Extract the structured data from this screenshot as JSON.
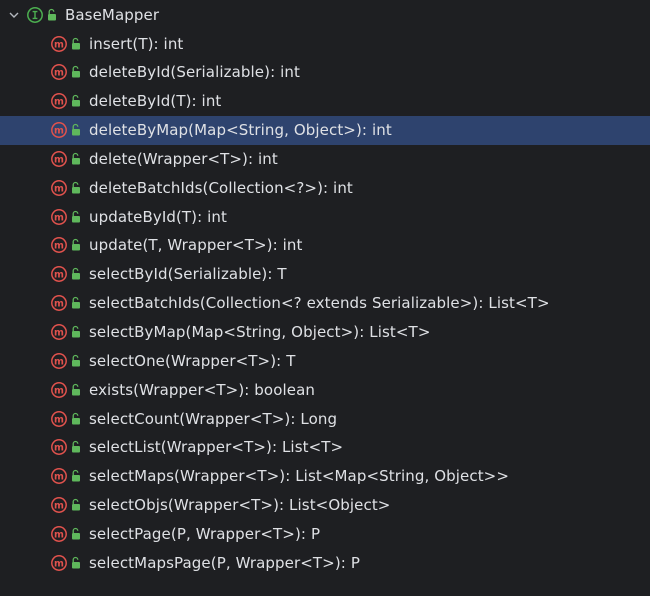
{
  "tree": {
    "root": {
      "label": "BaseMapper",
      "icon": "interface-icon",
      "visibility_icon": "public-lock-icon",
      "expanded": true
    },
    "methods": [
      {
        "label": "insert(T): int"
      },
      {
        "label": "deleteById(Serializable): int"
      },
      {
        "label": "deleteById(T): int"
      },
      {
        "label": "deleteByMap(Map<String, Object>): int",
        "selected": true
      },
      {
        "label": "delete(Wrapper<T>): int"
      },
      {
        "label": "deleteBatchIds(Collection<?>): int"
      },
      {
        "label": "updateById(T): int"
      },
      {
        "label": "update(T, Wrapper<T>): int"
      },
      {
        "label": "selectById(Serializable): T"
      },
      {
        "label": "selectBatchIds(Collection<? extends Serializable>): List<T>"
      },
      {
        "label": "selectByMap(Map<String, Object>): List<T>"
      },
      {
        "label": "selectOne(Wrapper<T>): T"
      },
      {
        "label": "exists(Wrapper<T>): boolean"
      },
      {
        "label": "selectCount(Wrapper<T>): Long"
      },
      {
        "label": "selectList(Wrapper<T>): List<T>"
      },
      {
        "label": "selectMaps(Wrapper<T>): List<Map<String, Object>>"
      },
      {
        "label": "selectObjs(Wrapper<T>): List<Object>"
      },
      {
        "label": "selectPage(P, Wrapper<T>): P"
      },
      {
        "label": "selectMapsPage(P, Wrapper<T>): P"
      }
    ]
  },
  "colors": {
    "background": "#1e1f22",
    "selection": "#2e436e",
    "text": "#dfe1e5",
    "method_badge": "#e0524d",
    "interface_badge": "#4caf50",
    "lock": "#5fb85c"
  }
}
